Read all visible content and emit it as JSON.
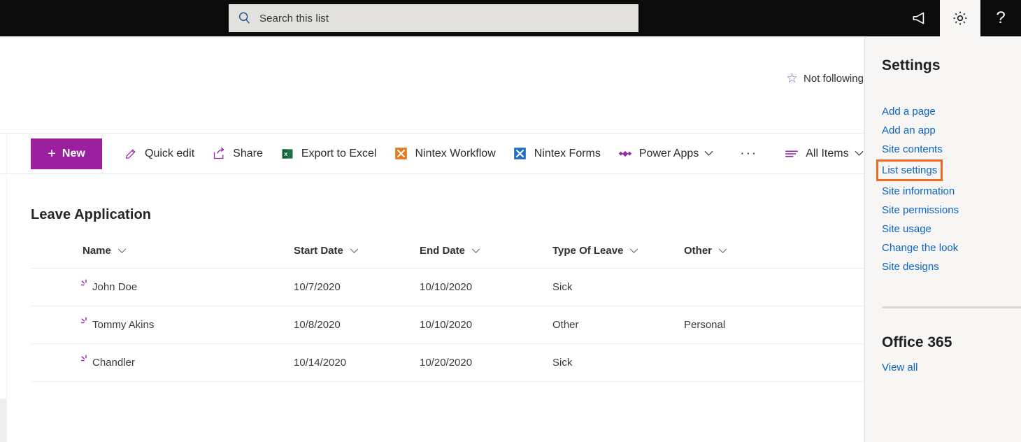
{
  "suitebar": {
    "search": {
      "placeholder": "Search this list",
      "value": "",
      "icon": "search-icon"
    },
    "actions": [
      {
        "name": "megaphone-icon",
        "label": "✉",
        "active": false
      },
      {
        "name": "gear-icon",
        "label": "⚙",
        "active": true
      },
      {
        "name": "help-icon",
        "label": "?",
        "active": false
      }
    ]
  },
  "header": {
    "follow": {
      "label": "Not following",
      "icon": "star-icon"
    }
  },
  "commandbar": {
    "new_label": "New",
    "new_plus": "+",
    "items": [
      {
        "label": "Quick edit",
        "icon": "pencil-icon",
        "chevron": false
      },
      {
        "label": "Share",
        "icon": "share-icon",
        "chevron": false
      },
      {
        "label": "Export to Excel",
        "icon": "excel-icon",
        "chevron": false
      },
      {
        "label": "Nintex Workflow",
        "icon": "nintex-workflow-icon",
        "chevron": false
      },
      {
        "label": "Nintex Forms",
        "icon": "nintex-forms-icon",
        "chevron": false
      },
      {
        "label": "Power Apps",
        "icon": "powerapps-icon",
        "chevron": true
      }
    ],
    "overflow_label": "···",
    "view_label": "All Items",
    "view_icon": "list-view-icon"
  },
  "list": {
    "title": "Leave Application",
    "columns": [
      "Name",
      "Start Date",
      "End Date",
      "Type Of Leave",
      "Other"
    ],
    "rows": [
      {
        "name": "John Doe",
        "start": "10/7/2020",
        "end": "10/10/2020",
        "type": "Sick",
        "other": ""
      },
      {
        "name": "Tommy Akins",
        "start": "10/8/2020",
        "end": "10/10/2020",
        "type": "Other",
        "other": "Personal"
      },
      {
        "name": "Chandler",
        "start": "10/14/2020",
        "end": "10/20/2020",
        "type": "Sick",
        "other": ""
      }
    ]
  },
  "panel": {
    "title": "Settings",
    "links": [
      {
        "label": "Add a page",
        "highlighted": false
      },
      {
        "label": "Add an app",
        "highlighted": false
      },
      {
        "label": "Site contents",
        "highlighted": false
      },
      {
        "label": "List settings",
        "highlighted": true
      },
      {
        "label": "Site information",
        "highlighted": false
      },
      {
        "label": "Site permissions",
        "highlighted": false
      },
      {
        "label": "Site usage",
        "highlighted": false
      },
      {
        "label": "Change the look",
        "highlighted": false
      },
      {
        "label": "Site designs",
        "highlighted": false
      }
    ],
    "office_title": "Office 365",
    "view_all_label": "View all"
  },
  "colors": {
    "suitebar_bg": "#0b0b0b",
    "accent_purple": "#9c1fa0",
    "link_blue": "#0c64c0",
    "highlight_orange": "#f26a21",
    "panel_bg": "#f7f6f5",
    "search_bg": "#e3e1de",
    "excel_green": "#1e7145",
    "nintex_orange": "#e8761b",
    "nintex_blue": "#1f6fc4"
  }
}
